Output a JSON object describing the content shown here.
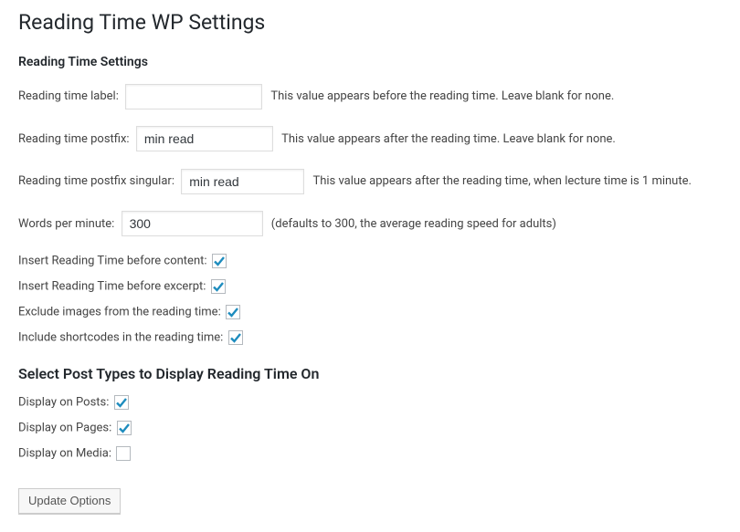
{
  "page": {
    "title": "Reading Time WP Settings"
  },
  "section1": {
    "heading": "Reading Time Settings",
    "label_field": {
      "label": "Reading time label:",
      "value": "",
      "desc": "This value appears before the reading time. Leave blank for none."
    },
    "postfix_field": {
      "label": "Reading time postfix:",
      "value": "min read",
      "desc": "This value appears after the reading time. Leave blank for none."
    },
    "postfix_singular_field": {
      "label": "Reading time postfix singular:",
      "value": "min read",
      "desc": "This value appears after the reading time, when lecture time is 1 minute."
    },
    "wpm_field": {
      "label": "Words per minute:",
      "value": "300",
      "desc": "(defaults to 300, the average reading speed for adults)"
    },
    "checks": {
      "before_content": {
        "label": "Insert Reading Time before content:",
        "checked": true
      },
      "before_excerpt": {
        "label": "Insert Reading Time before excerpt:",
        "checked": true
      },
      "exclude_images": {
        "label": "Exclude images from the reading time:",
        "checked": true
      },
      "include_shortcodes": {
        "label": "Include shortcodes in the reading time:",
        "checked": true
      }
    }
  },
  "section2": {
    "heading": "Select Post Types to Display Reading Time On",
    "checks": {
      "posts": {
        "label": "Display on Posts:",
        "checked": true
      },
      "pages": {
        "label": "Display on Pages:",
        "checked": true
      },
      "media": {
        "label": "Display on Media:",
        "checked": false
      }
    }
  },
  "submit": {
    "label": "Update Options"
  }
}
